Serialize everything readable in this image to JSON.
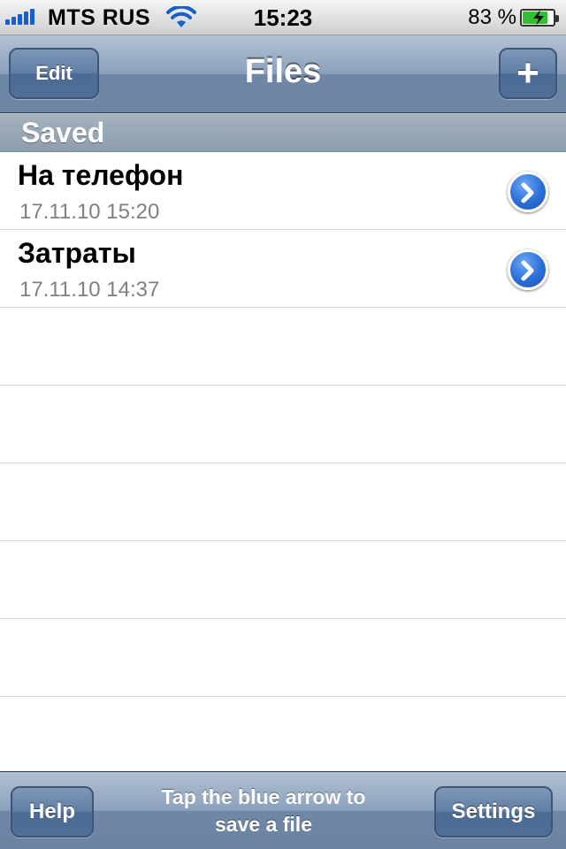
{
  "status_bar": {
    "carrier": "MTS RUS",
    "time": "15:23",
    "battery_percent": "83 %",
    "battery_level": 0.83,
    "icons": [
      "signal-icon",
      "wifi-icon",
      "battery-charging-icon"
    ]
  },
  "nav": {
    "title": "Files",
    "edit_label": "Edit",
    "add_label": "+"
  },
  "section": {
    "header": "Saved"
  },
  "files": [
    {
      "name": "На телефон",
      "date": "17.11.10 15:20"
    },
    {
      "name": "Затраты",
      "date": "17.11.10 14:37"
    }
  ],
  "toolbar": {
    "help_label": "Help",
    "hint_line1": "Tap the blue arrow to",
    "hint_line2": "save a file",
    "settings_label": "Settings"
  },
  "colors": {
    "accent_blue": "#2a6ed6",
    "nav_bar": "#8aa0bb",
    "section_header": "#9aa8b6",
    "secondary_text": "#808080"
  }
}
